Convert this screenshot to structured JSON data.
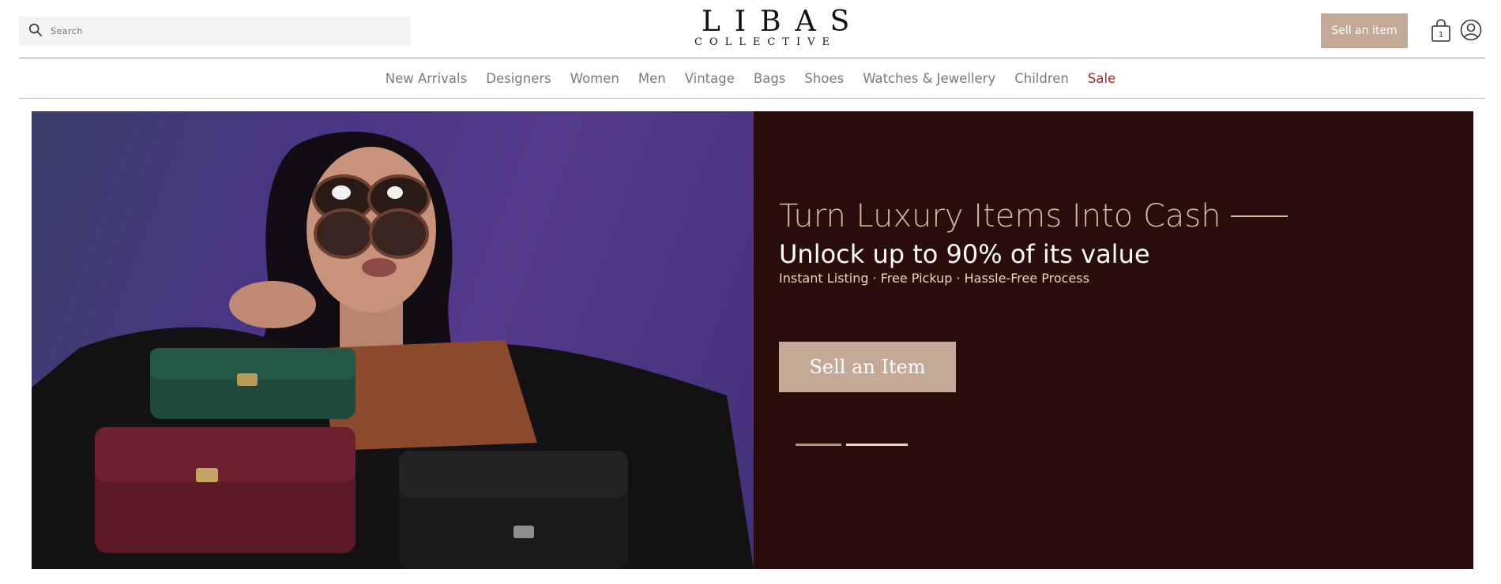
{
  "header": {
    "search_placeholder": "Search",
    "logo_main": "LIBAS",
    "logo_sub": "COLLECTIVE",
    "sell_label": "Sell an item",
    "cart_count": "1"
  },
  "nav": {
    "items": [
      {
        "label": "New Arrivals"
      },
      {
        "label": "Designers"
      },
      {
        "label": "Women"
      },
      {
        "label": "Men"
      },
      {
        "label": "Vintage"
      },
      {
        "label": "Bags"
      },
      {
        "label": "Shoes"
      },
      {
        "label": "Watches & Jewellery"
      },
      {
        "label": "Children"
      },
      {
        "label": "Sale"
      }
    ]
  },
  "hero": {
    "headline": "Turn Luxury Items Into Cash",
    "subheadline": "Unlock up to 90% of its value",
    "tagline": "Instant Listing · Free Pickup · Hassle-Free Process",
    "button_label": "Sell an Item"
  },
  "colors": {
    "accent": "#c4a996",
    "hero_bg": "#2a0d0a",
    "headline": "#d9b6a2",
    "sale": "#b22222"
  },
  "icons": {
    "search": "search-icon",
    "cart": "shopping-bag-icon",
    "account": "user-account-icon"
  }
}
